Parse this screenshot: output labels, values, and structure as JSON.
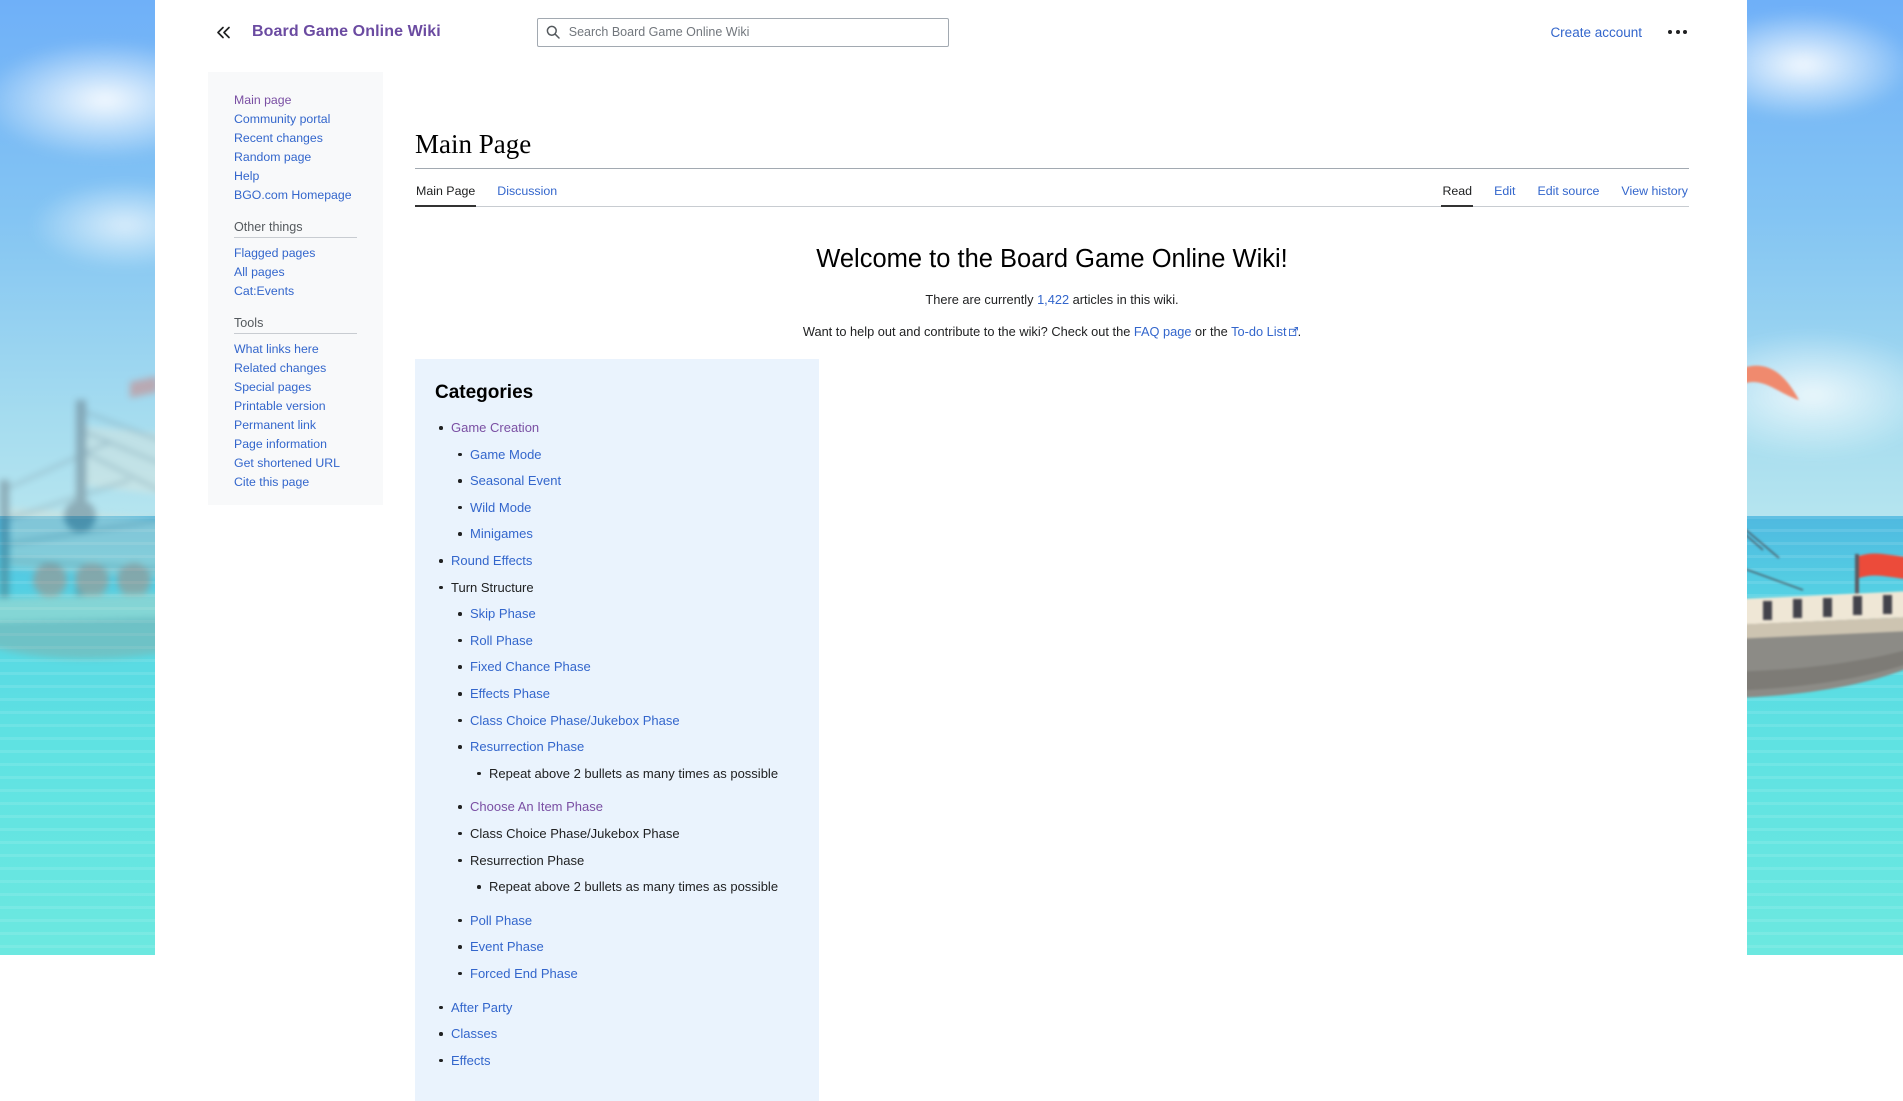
{
  "header": {
    "collapse_icon": "chevrons-left-icon",
    "wiki_title": "Board Game Online Wiki",
    "search": {
      "icon": "search-icon",
      "value": "",
      "placeholder": "Search Board Game Online Wiki"
    },
    "create_account_label": "Create account",
    "more_menu_icon": "ellipsis-icon"
  },
  "sidebar": {
    "navigation": [
      {
        "label": "Main page",
        "visited": true
      },
      {
        "label": "Community portal",
        "visited": false
      },
      {
        "label": "Recent changes",
        "visited": false
      },
      {
        "label": "Random page",
        "visited": false
      },
      {
        "label": "Help",
        "visited": false
      },
      {
        "label": "BGO.com Homepage",
        "visited": false
      }
    ],
    "other_things_label": "Other things",
    "other_things": [
      {
        "label": "Flagged pages",
        "visited": false
      },
      {
        "label": "All pages",
        "visited": false
      },
      {
        "label": "Cat:Events",
        "visited": false
      }
    ],
    "tools_label": "Tools",
    "tools": [
      {
        "label": "What links here",
        "visited": false
      },
      {
        "label": "Related changes",
        "visited": false
      },
      {
        "label": "Special pages",
        "visited": false
      },
      {
        "label": "Printable version",
        "visited": false
      },
      {
        "label": "Permanent link",
        "visited": false
      },
      {
        "label": "Page information",
        "visited": false
      },
      {
        "label": "Get shortened URL",
        "visited": false
      },
      {
        "label": "Cite this page",
        "visited": false
      }
    ]
  },
  "main": {
    "page_title": "Main Page",
    "namespace_tabs": [
      {
        "label": "Main Page",
        "active": true
      },
      {
        "label": "Discussion",
        "active": false
      }
    ],
    "view_tabs": [
      {
        "label": "Read",
        "active": true
      },
      {
        "label": "Edit",
        "active": false
      },
      {
        "label": "Edit source",
        "active": false
      },
      {
        "label": "View history",
        "active": false
      }
    ],
    "welcome_heading": "Welcome to the Board Game Online Wiki!",
    "article_count_prefix": "There are currently ",
    "article_count": "1,422",
    "article_count_suffix": " articles in this wiki.",
    "contribute_prefix": "Want to help out and contribute to the wiki? Check out the ",
    "faq_link": "FAQ page",
    "contribute_middle": " or the ",
    "todo_link": "To-do List",
    "external_icon": "external-link-icon",
    "contribute_suffix": ".",
    "categories_heading": "Categories",
    "categories": [
      {
        "label": "Game Creation",
        "level": 1,
        "link": true,
        "visited": true
      },
      {
        "label": "Game Mode",
        "level": 2,
        "link": true,
        "visited": false
      },
      {
        "label": "Seasonal Event",
        "level": 2,
        "link": true,
        "visited": false
      },
      {
        "label": "Wild Mode",
        "level": 2,
        "link": true,
        "visited": false
      },
      {
        "label": "Minigames",
        "level": 2,
        "link": true,
        "visited": false
      },
      {
        "label": "Round Effects",
        "level": 1,
        "link": true,
        "visited": false
      },
      {
        "label": "Turn Structure",
        "level": 1,
        "link": false,
        "visited": false
      },
      {
        "label": "Skip Phase",
        "level": 2,
        "link": true,
        "visited": false
      },
      {
        "label": "Roll Phase",
        "level": 2,
        "link": true,
        "visited": false
      },
      {
        "label": "Fixed Chance Phase",
        "level": 2,
        "link": true,
        "visited": false
      },
      {
        "label": "Effects Phase",
        "level": 2,
        "link": true,
        "visited": false
      },
      {
        "label": "Class Choice Phase/Jukebox Phase",
        "level": 2,
        "link": true,
        "visited": false
      },
      {
        "label": "Resurrection Phase",
        "level": 2,
        "link": true,
        "visited": false
      },
      {
        "label": "Repeat above 2 bullets as many times as possible",
        "level": 3,
        "link": false,
        "visited": false
      },
      {
        "label": "Choose An Item Phase",
        "level": 2,
        "link": true,
        "visited": true,
        "spaced": true
      },
      {
        "label": "Class Choice Phase/Jukebox Phase",
        "level": 2,
        "link": false,
        "visited": false
      },
      {
        "label": "Resurrection Phase",
        "level": 2,
        "link": false,
        "visited": false
      },
      {
        "label": "Repeat above 2 bullets as many times as possible",
        "level": 3,
        "link": false,
        "visited": false
      },
      {
        "label": "Poll Phase",
        "level": 2,
        "link": true,
        "visited": false,
        "spaced": true
      },
      {
        "label": "Event Phase",
        "level": 2,
        "link": true,
        "visited": false
      },
      {
        "label": "Forced End Phase",
        "level": 2,
        "link": true,
        "visited": false
      },
      {
        "label": "After Party",
        "level": 1,
        "link": true,
        "visited": false,
        "spaced": true
      },
      {
        "label": "Classes",
        "level": 1,
        "link": true,
        "visited": false
      },
      {
        "label": "Effects",
        "level": 1,
        "link": true,
        "visited": false
      }
    ]
  },
  "colors": {
    "link": "#3366cc",
    "visited_link": "#7a4fa3",
    "brand": "#6b4ba1",
    "sidebar_bg": "#f8f9fa",
    "categories_bg": "#eaf3fd",
    "sky": "#79b4f7",
    "sea": "#5fe0e4"
  }
}
